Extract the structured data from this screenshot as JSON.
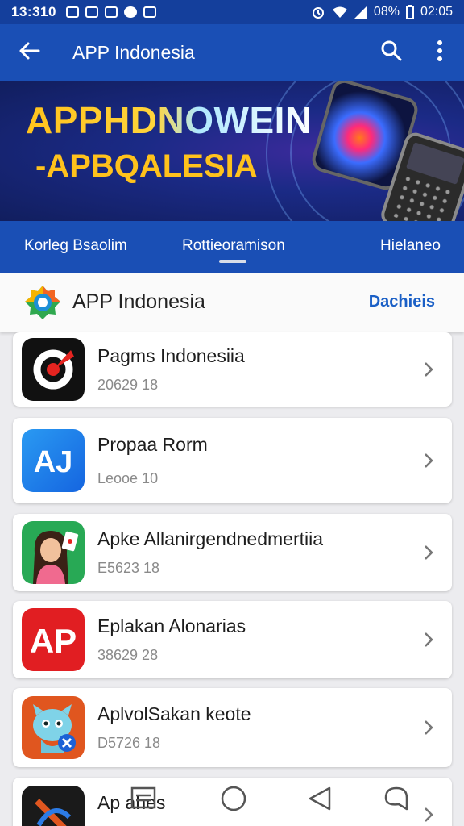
{
  "status_bar": {
    "time": "13:310",
    "battery": "08%",
    "clock": "02:05"
  },
  "toolbar": {
    "title": "APP Indonesia",
    "icons": [
      "arrow-left-icon",
      "search-icon",
      "more-vert-icon"
    ]
  },
  "banner": {
    "line1": "APPHDNOWEIN",
    "line2": "-APBQALESIA"
  },
  "tabs": [
    {
      "label": "Korleg Bsaolim"
    },
    {
      "label": "Rottieoramison"
    },
    {
      "label": "Hielaneo"
    }
  ],
  "header": {
    "title": "APP Indonesia",
    "action": "Dachieis"
  },
  "apps": [
    {
      "name": "Pagms Indonesiia",
      "meta": "20629 18",
      "icon": "red-ring-logo-icon"
    },
    {
      "name": "Propaa Rorm",
      "meta": "Leooe 10",
      "icon": "aj-logo-icon"
    },
    {
      "name": "Apke Allanirgendnedmertiia",
      "meta": "E5623 18",
      "icon": "woman-character-icon"
    },
    {
      "name": "Eplakan Alonarias",
      "meta": "38629 28",
      "icon": "ap-logo-icon"
    },
    {
      "name": "AplvolSakan keote",
      "meta": "D5726 18",
      "icon": "robot-mascot-icon"
    },
    {
      "name": "Ap ahes",
      "meta": "",
      "icon": "dark-logo-icon"
    }
  ],
  "nav": {
    "icons": [
      "recents-icon",
      "home-icon",
      "back-icon",
      "assistant-icon"
    ]
  },
  "colors": {
    "primary": "#1a4fb5",
    "status": "#143f9c",
    "accent": "#1a5fc6",
    "banner_text": "#ffc21c"
  }
}
